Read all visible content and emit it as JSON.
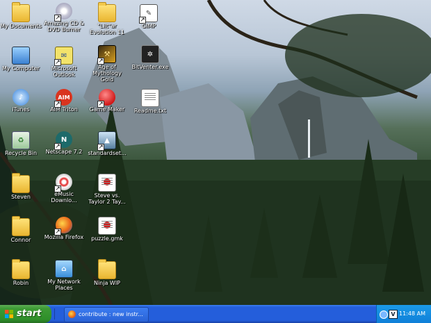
{
  "desktop": {
    "icons": [
      {
        "label": "My Documents",
        "icon": "folder-icon",
        "kind": "folder"
      },
      {
        "label": "Amazing CD & DVD Burner",
        "icon": "cd-burner-icon",
        "kind": "app"
      },
      {
        "label": "\"Lilt\"ar Evolution 11",
        "icon": "folder-icon",
        "kind": "folder"
      },
      {
        "label": "GIMP",
        "icon": "gimp-icon",
        "kind": "app"
      },
      {
        "label": "My Computer",
        "icon": "computer-icon",
        "kind": "app"
      },
      {
        "label": "Microsoft Outlook",
        "icon": "outlook-icon",
        "kind": "app"
      },
      {
        "label": "Age of Mythology Gold",
        "icon": "age-of-mythology-icon",
        "kind": "app"
      },
      {
        "label": "BitVenter.exe",
        "icon": "bitventer-icon",
        "kind": "app"
      },
      {
        "label": "iTunes",
        "icon": "itunes-icon",
        "kind": "app"
      },
      {
        "label": "AIM Triton",
        "icon": "aim-icon",
        "kind": "app"
      },
      {
        "label": "Game Maker",
        "icon": "game-maker-icon",
        "kind": "app"
      },
      {
        "label": "Readme.txt",
        "icon": "text-file-icon",
        "kind": "doc"
      },
      {
        "label": "Recycle Bin",
        "icon": "recycle-bin-icon",
        "kind": "app"
      },
      {
        "label": "Netscape 7.2",
        "icon": "netscape-icon",
        "kind": "app"
      },
      {
        "label": "standardset...",
        "icon": "standardset-icon",
        "kind": "app"
      },
      {
        "label": "Steven",
        "icon": "folder-icon",
        "kind": "folder"
      },
      {
        "label": "eMusic Downlo...",
        "icon": "emusic-icon",
        "kind": "app"
      },
      {
        "label": "Steve vs. Taylor 2 Tay...",
        "icon": "gamemaker-file-icon",
        "kind": "doc"
      },
      {
        "label": "Connor",
        "icon": "folder-icon",
        "kind": "folder"
      },
      {
        "label": "Mozilla Firefox",
        "icon": "firefox-icon",
        "kind": "app"
      },
      {
        "label": "puzzle.gmk",
        "icon": "gamemaker-file-icon",
        "kind": "doc"
      },
      {
        "label": "Robin",
        "icon": "folder-icon",
        "kind": "folder"
      },
      {
        "label": "My Network Places",
        "icon": "network-places-icon",
        "kind": "app"
      },
      {
        "label": "Ninja WIP",
        "icon": "folder-icon",
        "kind": "folder"
      }
    ]
  },
  "taskbar": {
    "start_label": "start",
    "task_button": "contribute : new instr...",
    "clock": "11:48 AM",
    "colors": {
      "taskbar": "#245edb",
      "start": "#3c9a34",
      "tray": "#0f7fd8"
    }
  }
}
